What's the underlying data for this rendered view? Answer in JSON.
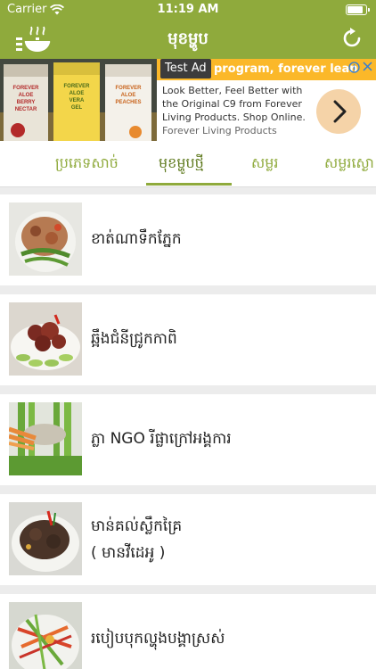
{
  "status": {
    "carrier": "Carrier",
    "time": "11:19 AM",
    "battery_level": 0.9
  },
  "nav": {
    "title": "មុខម្ហូប",
    "menu_icon": "pot-menu-icon",
    "refresh_icon": "refresh-icon"
  },
  "ad": {
    "badge": "Test Ad",
    "headline": "program, forever lean",
    "body": "Look Better, Feel Better with the Original C9 from Forever Living Products. Shop Online.",
    "advertiser": "Forever Living Products",
    "product_labels": [
      "FOREVER ALOE BERRY NECTAR",
      "FOREVER ALOE VERA GEL",
      "FOREVER ALOE PEACHES"
    ]
  },
  "tabs": [
    {
      "label": "ប្រភេទសាច់",
      "active": false
    },
    {
      "label": "មុខម្ហូបថ្មី",
      "active": true
    },
    {
      "label": "សម្លរ",
      "active": false
    },
    {
      "label": "សម្លរស្ងោ",
      "active": false
    }
  ],
  "recipes": [
    {
      "title": "ខាត់ណាទឹកភ្នែក"
    },
    {
      "title": "ឆ្អឹងជំនីជ្រូកកាពិ"
    },
    {
      "title": "ភ្លា NGO រីផ្លាក្រៅអង្គការ"
    },
    {
      "title": "មាន់គល់ស្លឹកគ្រៃ",
      "subtitle": "( មានវីដេអូ )"
    },
    {
      "title": "របៀបបុកល្ហុងបង្គាស្រស់"
    }
  ],
  "colors": {
    "header": "#8faa3c",
    "accent": "#8faa3c",
    "ad_banner": "#fbb829"
  }
}
